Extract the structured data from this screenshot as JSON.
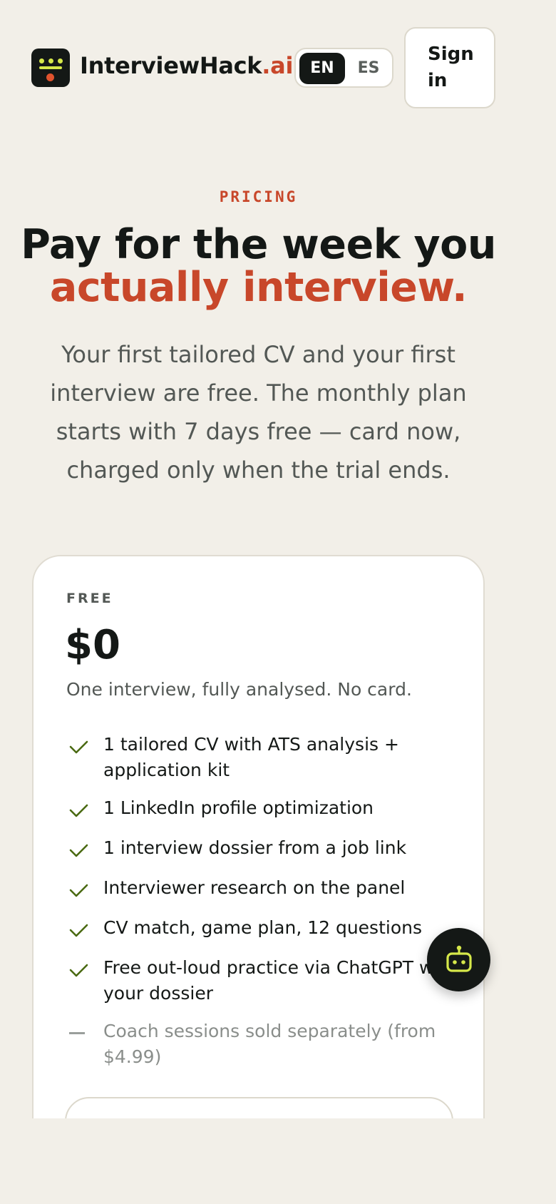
{
  "header": {
    "brand_name": "InterviewHack",
    "brand_suffix": ".ai",
    "lang_options": [
      "EN",
      "ES"
    ],
    "lang_selected": "EN",
    "signin_label": "Sign in"
  },
  "hero": {
    "eyebrow": "PRICING",
    "headline_line1": "Pay for the week you",
    "headline_line2": "actually interview.",
    "subtext": "Your first tailored CV and your first interview are free. The monthly plan starts with 7 days free — card now, charged only when the trial ends."
  },
  "plan": {
    "tier": "FREE",
    "price": "$0",
    "tagline": "One interview, fully analysed. No card.",
    "features": [
      {
        "text": "1 tailored CV with ATS analysis + application kit",
        "included": true
      },
      {
        "text": "1 LinkedIn profile optimization",
        "included": true
      },
      {
        "text": "1 interview dossier from a job link",
        "included": true
      },
      {
        "text": "Interviewer research on the panel",
        "included": true
      },
      {
        "text": "CV match, game plan, 12 questions",
        "included": true
      },
      {
        "text": "Free out-loud practice via ChatGPT with your dossier",
        "included": true
      },
      {
        "text": "Coach sessions sold separately (from $4.99)",
        "included": false
      }
    ]
  },
  "colors": {
    "accent": "#c8472a",
    "check": "#4a6a12",
    "lime": "#d6e84a",
    "ink": "#141816",
    "background": "#f2efe8"
  },
  "icons": {
    "logo": "interviewhack-logo-icon",
    "included": "check-icon",
    "excluded": "dash-icon",
    "assistant": "robot-icon"
  }
}
